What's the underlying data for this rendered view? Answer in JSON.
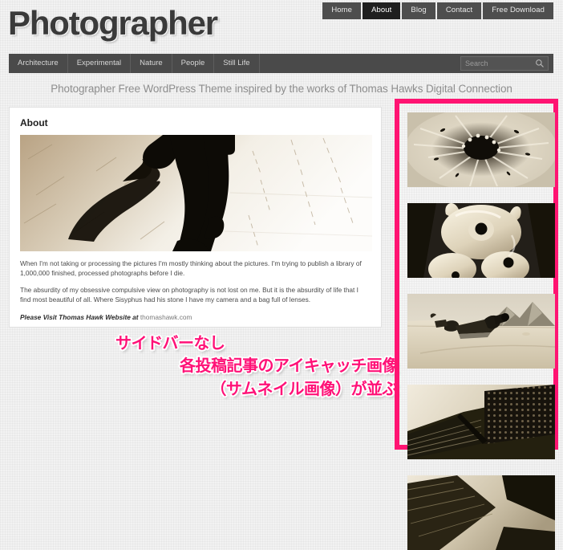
{
  "site": {
    "title": "Photographer",
    "tagline": "Photographer Free WordPress Theme inspired by the works of Thomas Hawks Digital Connection",
    "accent_color": "#ff1472",
    "nav_bg_color": "#4a4a4a",
    "active_nav_color": "#1f1f1f"
  },
  "topnav": {
    "items": [
      {
        "label": "Home",
        "active": false
      },
      {
        "label": "About",
        "active": true
      },
      {
        "label": "Blog",
        "active": false
      },
      {
        "label": "Contact",
        "active": false
      },
      {
        "label": "Free Download",
        "active": false
      }
    ]
  },
  "subnav": {
    "items": [
      {
        "label": "Architecture"
      },
      {
        "label": "Experimental"
      },
      {
        "label": "Nature"
      },
      {
        "label": "People"
      },
      {
        "label": "Still Life"
      }
    ],
    "search": {
      "placeholder": "Search",
      "value": "",
      "icon": "search-icon"
    }
  },
  "article": {
    "title": "About",
    "photo_alt": "high-contrast sepia photo of legs walking on pavement with long shadow",
    "paragraphs": [
      "When I'm not taking or processing the pictures I'm mostly thinking about the pictures. I'm trying to publish a library of 1,000,000 finished, processed photographs before I die.",
      "The absurdity of my obsessive compulsive view on photography is not lost on me. But it is the absurdity of life that I find most beautiful of all. Where Sisyphus had his stone I have my camera and a bag full of lenses."
    ],
    "link_line": {
      "prefix": "Please Visit Thomas Hawk Website at",
      "url_text": "thomashawk.com"
    }
  },
  "annotation": {
    "lines": [
      "サイドバーなし",
      "各投稿記事のアイキャッチ画像",
      "（サムネイル画像）が並ぶ"
    ],
    "color": "#ff1177"
  },
  "thumbnails": {
    "items": [
      {
        "alt": "sepia macro photo of a flower bloom with dark center"
      },
      {
        "alt": "sepia photo of a glossy ceramic bunny figurine close-up"
      },
      {
        "alt": "sepia photo of a photographer lying prone in a desert with mountains"
      },
      {
        "alt": "sepia photo of a dark perforated architectural structure"
      },
      {
        "alt": "sepia photo of dark angular architectural lines"
      }
    ]
  }
}
